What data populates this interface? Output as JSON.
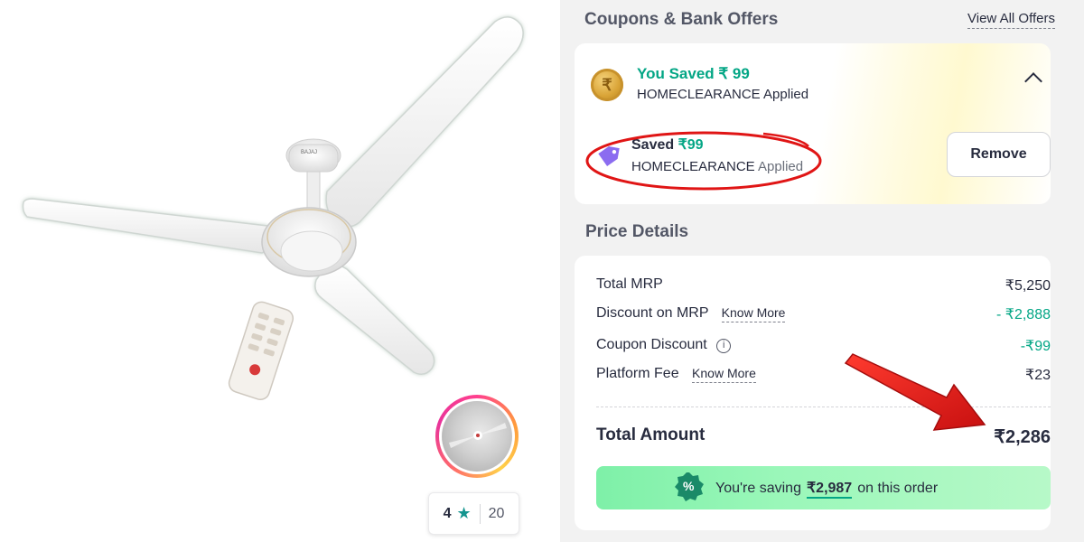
{
  "product": {
    "brand_mark": "BAJAJ",
    "rating": {
      "value": "4",
      "star": "★",
      "count": "20"
    }
  },
  "coupons": {
    "title": "Coupons & Bank Offers",
    "view_all": "View All Offers",
    "applied_banner": {
      "coin_symbol": "₹",
      "headline": "You Saved ₹ 99",
      "code": "HOMECLEARANCE",
      "applied_text": "Applied"
    },
    "applied_coupon": {
      "saved_label": "Saved",
      "saved_amount": "₹99",
      "code": "HOMECLEARANCE",
      "applied_text": "Applied",
      "remove_label": "Remove"
    }
  },
  "price_details": {
    "title": "Price Details",
    "rows": [
      {
        "label": "Total MRP",
        "value": "₹5,250"
      },
      {
        "label": "Discount on MRP",
        "link": "Know More",
        "value": "- ₹2,888"
      },
      {
        "label": "Coupon Discount",
        "info": "i",
        "value": "-₹99"
      },
      {
        "label": "Platform Fee",
        "link": "Know More",
        "value": "₹23"
      }
    ],
    "total_label": "Total Amount",
    "total_value": "₹2,286",
    "saving": {
      "prefix": "You're saving",
      "amount": "₹2,987",
      "suffix": "on this order",
      "badge_symbol": "%"
    }
  },
  "colors": {
    "green": "#03a685",
    "annotation_red": "#e01515",
    "banner_green": "#9af7b9"
  },
  "icons": [
    "coin-rupee-icon",
    "chevron-up-icon",
    "tag-icon",
    "info-icon",
    "star-icon",
    "percent-badge-icon",
    "annotation-arrow-icon"
  ]
}
